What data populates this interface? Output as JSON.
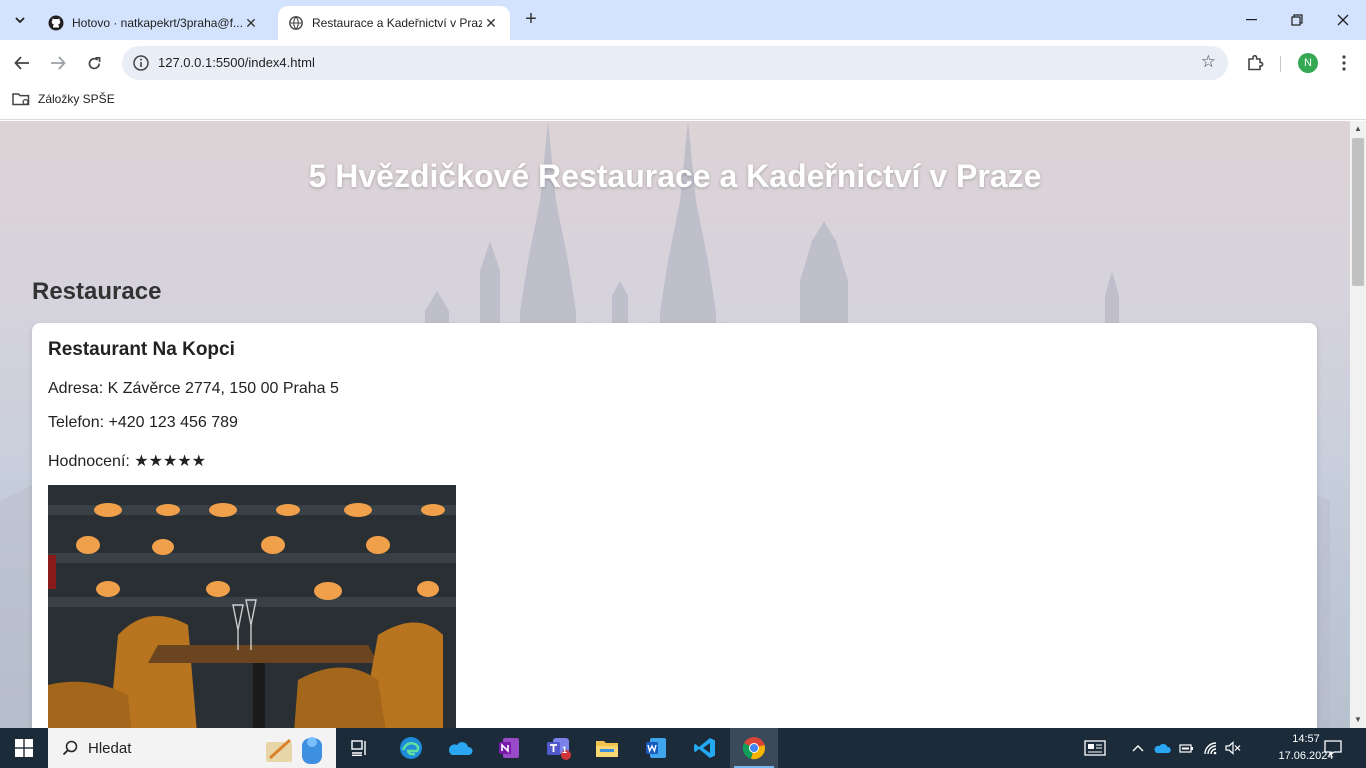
{
  "browser": {
    "tabs": [
      {
        "title": "Hotovo · natkapekrt/3praha@f...",
        "icon": "github-icon",
        "active": false
      },
      {
        "title": "Restaurace a Kadeřnictví v Praze",
        "icon": "globe-icon",
        "active": true
      }
    ],
    "url": "127.0.0.1:5500/index4.html",
    "profile_initial": "N",
    "bookmarks": [
      {
        "label": "Záložky SPŠE",
        "icon": "bookmark-folder-icon"
      }
    ]
  },
  "page": {
    "title": "5 Hvězdičkové Restaurace a Kadeřnictví v Praze",
    "section_title": "Restaurace",
    "restaurant": {
      "name": "Restaurant Na Kopci",
      "address": "Adresa: K Závěrce 2774, 150 00 Praha 5",
      "phone": "Telefon: +420 123 456 789",
      "rating": "Hodnocení: ★★★★★",
      "rating_stars": 5
    }
  },
  "taskbar": {
    "search_placeholder": "Hledat",
    "apps": [
      "task-view-icon",
      "edge-icon",
      "onedrive-icon",
      "onenote-icon",
      "teams-icon",
      "file-explorer-icon",
      "word-icon",
      "vscode-icon",
      "chrome-icon"
    ],
    "teams_badge": "1",
    "time": "14:57",
    "date": "17.06.2024"
  },
  "colors": {
    "tabstrip": "#d3e3fd",
    "omnibox": "#e9eef6",
    "profile": "#34a853",
    "taskbar": "#1b2b3a"
  }
}
